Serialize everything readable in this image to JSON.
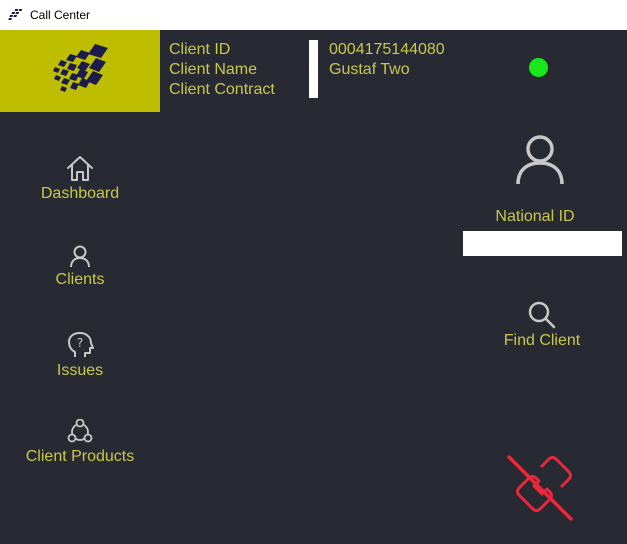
{
  "window": {
    "title": "Call Center"
  },
  "client": {
    "labels": {
      "id": "Client ID",
      "name": "Client Name",
      "contract": "Client Contract"
    },
    "values": {
      "id": "0004175144080",
      "name": "Gustaf Two",
      "contract": ""
    },
    "status_color": "#19e81c"
  },
  "nav": {
    "dashboard": "Dashboard",
    "clients": "Clients",
    "issues": "Issues",
    "client_products": "Client Products"
  },
  "search": {
    "national_id_label": "National ID",
    "national_id_value": "",
    "find_label": "Find Client"
  },
  "colors": {
    "background": "#282a33",
    "accent": "#c8c84a",
    "logo_bg": "#bfbd00",
    "hangup": "#e8283c"
  }
}
